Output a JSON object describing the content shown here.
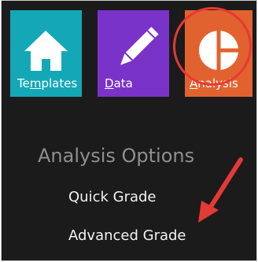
{
  "tiles": [
    {
      "id": "templates",
      "label_pre": "Te",
      "label_ul": "m",
      "label_post": "plates",
      "icon": "home-icon",
      "color": "#14a8b7"
    },
    {
      "id": "data",
      "label_pre": "",
      "label_ul": "D",
      "label_post": "ata",
      "icon": "pencil-icon",
      "color": "#7a33c9"
    },
    {
      "id": "analysis",
      "label_pre": "",
      "label_ul": "A",
      "label_post": "nalysis",
      "icon": "pie-chart-icon",
      "color": "#e2622f"
    }
  ],
  "options": {
    "heading": "Analysis Options",
    "quick_grade": "Quick Grade",
    "advanced_grade": "Advanced Grade"
  },
  "annotation": {
    "ring_color": "#e53935",
    "arrow_color": "#e53935"
  }
}
